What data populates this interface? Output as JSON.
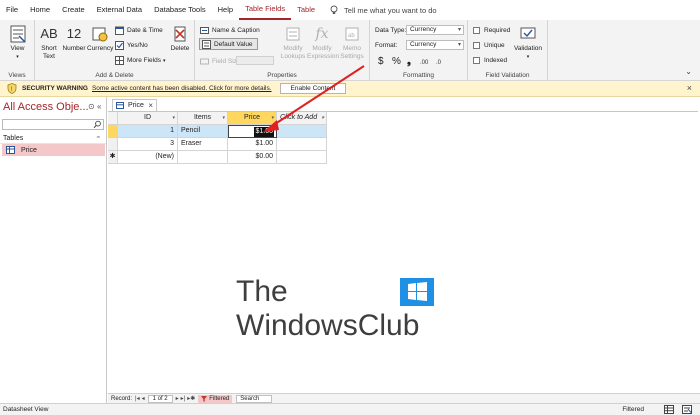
{
  "menu": {
    "items": [
      "File",
      "Home",
      "Create",
      "External Data",
      "Database Tools",
      "Help",
      "Table Fields",
      "Table"
    ],
    "active": "Table Fields",
    "tell_me": "Tell me what you want to do"
  },
  "ribbon": {
    "views": {
      "view_label": "View",
      "group": "Views"
    },
    "add_delete": {
      "short_text": "Short Text",
      "number": "Number",
      "currency": "Currency",
      "date_time": "Date & Time",
      "yes_no": "Yes/No",
      "more_fields": "More Fields",
      "delete": "Delete",
      "group": "Add & Delete"
    },
    "properties": {
      "name_caption": "Name & Caption",
      "default_value": "Default Value",
      "field_size": "Field Size",
      "modify_lookups": "Modify Lookups",
      "modify_expression": "Modify Expression",
      "memo_settings": "Memo Settings",
      "group": "Properties"
    },
    "formatting": {
      "data_type_label": "Data Type:",
      "data_type_value": "Currency",
      "format_label": "Format:",
      "format_value": "Currency",
      "currency_symbol": "$",
      "percent_symbol": "%",
      "comma_symbol": "❟",
      "group": "Formatting"
    },
    "validation": {
      "required": "Required",
      "unique": "Unique",
      "indexed": "Indexed",
      "validation": "Validation",
      "group": "Field Validation"
    }
  },
  "security": {
    "title": "SECURITY WARNING",
    "message": "Some active content has been disabled. Click for more details.",
    "enable_button": "Enable Content"
  },
  "nav": {
    "title": "All Access Obje...",
    "group": "Tables",
    "items": [
      "Price"
    ]
  },
  "document": {
    "tab": "Price",
    "columns": [
      "ID",
      "Items",
      "Price",
      "Click to Add"
    ],
    "rows": [
      {
        "id": "1",
        "item": "Pencil",
        "price": "$1.00"
      },
      {
        "id": "3",
        "item": "Eraser",
        "price": "$1.00"
      },
      {
        "id": "(New)",
        "item": "",
        "price": "$0.00"
      }
    ]
  },
  "watermark": {
    "line1": "The",
    "line2": "WindowsClub"
  },
  "record_nav": {
    "label": "Record:",
    "position": "1 of 2",
    "filtered": "Filtered",
    "search": "Search"
  },
  "status": {
    "left": "Datasheet View",
    "right": "Filtered"
  },
  "colors": {
    "accent": "#a4262c",
    "header_highlight": "#ffd75e",
    "selected_row": "#cde6f7",
    "warning_bar": "#fff4ce",
    "arrow": "#e02020"
  }
}
